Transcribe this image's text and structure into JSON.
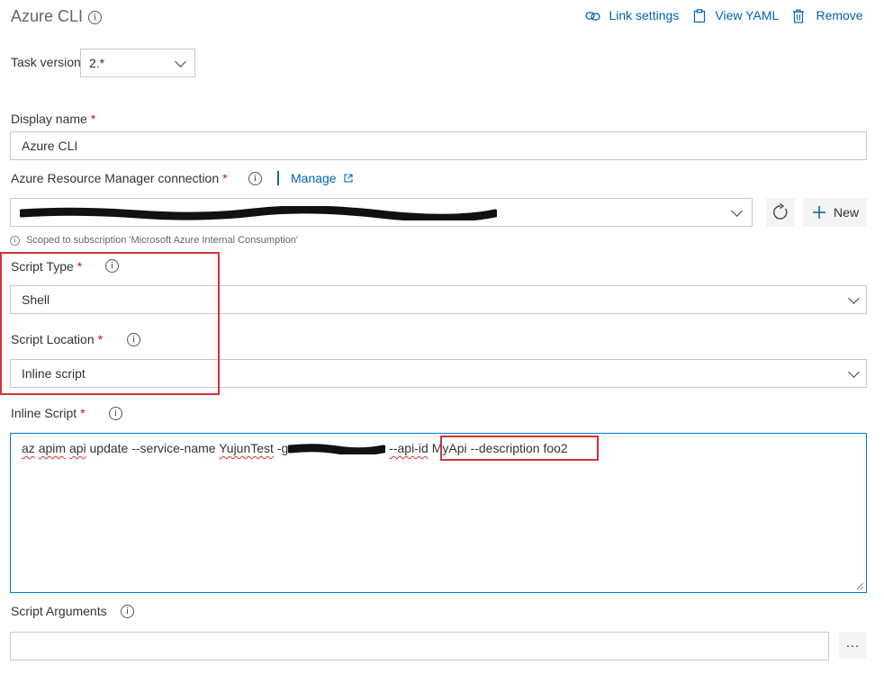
{
  "header": {
    "title": "Azure CLI",
    "actions": {
      "link_settings": "Link settings",
      "view_yaml": "View YAML",
      "remove": "Remove"
    }
  },
  "task_version": {
    "label": "Task version",
    "value": "2.*"
  },
  "display_name": {
    "label": "Display name",
    "required": "*",
    "value": "Azure CLI"
  },
  "arm_connection": {
    "label": "Azure Resource Manager connection",
    "required": "*",
    "manage_link": "Manage",
    "scope_note": "Scoped to subscription 'Microsoft Azure Internal Consumption'",
    "new_button": "New"
  },
  "script_type": {
    "label": "Script Type",
    "required": "*",
    "value": "Shell"
  },
  "script_location": {
    "label": "Script Location",
    "required": "*",
    "value": "Inline script"
  },
  "inline_script": {
    "label": "Inline Script",
    "required": "*",
    "cmd_az": "az",
    "cmd_apim": "apim",
    "cmd_api": "api",
    "cmd_update": "update --service-name",
    "service_name": "YujunTest",
    "flag_g": "-g",
    "flag_api": "--api-id",
    "api_id": "MyApi",
    "desc": "--description foo2"
  },
  "script_arguments": {
    "label": "Script Arguments",
    "value": "",
    "more_button": "…"
  },
  "colors": {
    "accent": "#0063b1",
    "required": "#c50f1f",
    "highlight_box": "#d13438",
    "focus_border": "#0078d4"
  }
}
